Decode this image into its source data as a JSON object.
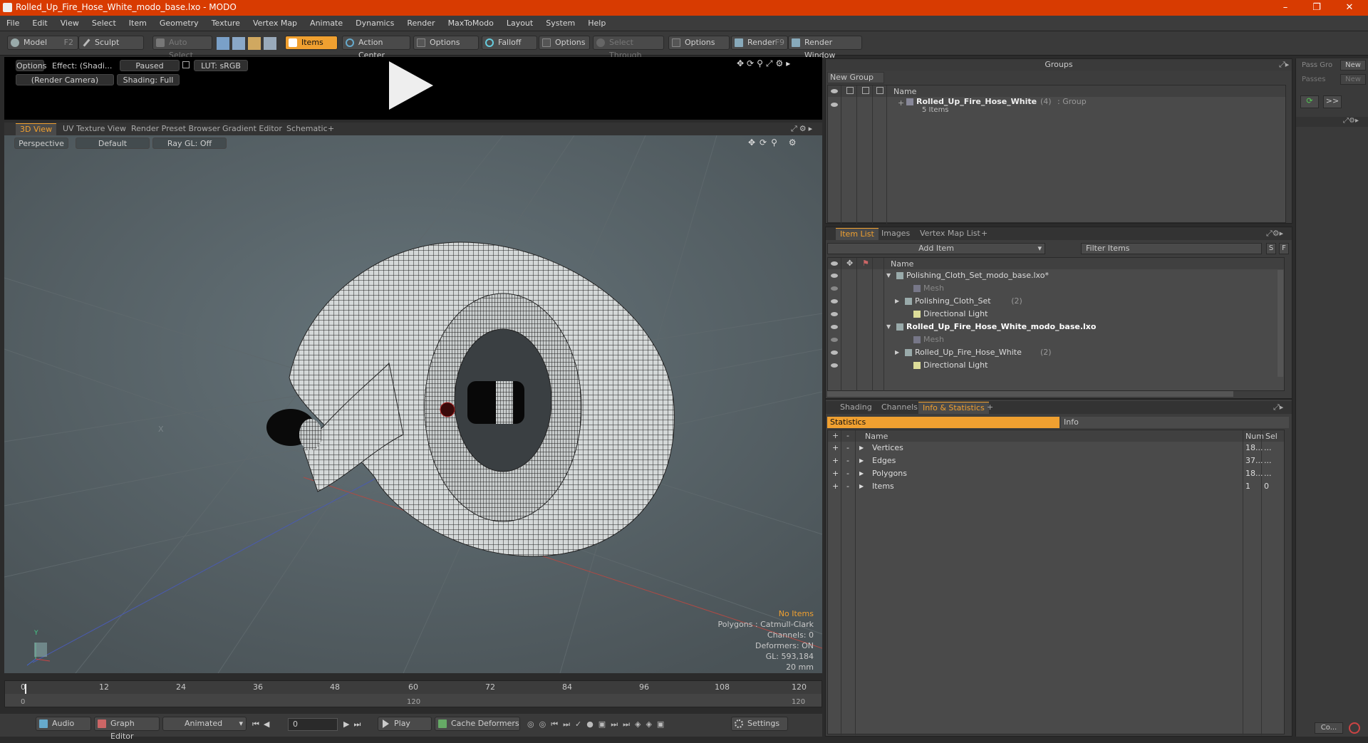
{
  "window": {
    "title": "Rolled_Up_Fire_Hose_White_modo_base.lxo - MODO"
  },
  "menu": [
    "File",
    "Edit",
    "View",
    "Select",
    "Item",
    "Geometry",
    "Texture",
    "Vertex Map",
    "Animate",
    "Dynamics",
    "Render",
    "MaxToModo",
    "Layout",
    "System",
    "Help"
  ],
  "toolbar": {
    "model": "Model",
    "model_key": "F2",
    "sculpt": "Sculpt",
    "auto_select": "Auto Select",
    "items": "Items",
    "action_center": "Action Center",
    "options1": "Options",
    "falloff": "Falloff",
    "options2": "Options",
    "select_through": "Select Through",
    "options3": "Options",
    "render": "Render",
    "render_key": "F9",
    "render_window": "Render Window"
  },
  "preview": {
    "options": "Options",
    "effect": "Effect: (Shadi...",
    "paused": "Paused",
    "lut": "LUT: sRGB",
    "camera": "(Render Camera)",
    "shading": "Shading: Full"
  },
  "viewtabs": [
    "3D View",
    "UV Texture View",
    "Render Preset Browser",
    "Gradient Editor",
    "Schematic",
    "+"
  ],
  "viewport": {
    "perspective": "Perspective",
    "default": "Default",
    "raygl": "Ray GL: Off",
    "axis_x": "X",
    "axis_y": "Y",
    "stats": {
      "no_items": "No Items",
      "polygons": "Polygons : Catmull-Clark",
      "channels": "Channels: 0",
      "deformers": "Deformers: ON",
      "gl": "GL: 593,184",
      "scale": "20 mm"
    }
  },
  "timeline": {
    "ticks": [
      "0",
      "12",
      "24",
      "36",
      "48",
      "60",
      "72",
      "84",
      "96",
      "108",
      "120"
    ],
    "start": "0",
    "mid": "120",
    "end": "120"
  },
  "bottom": {
    "audio": "Audio",
    "graph_editor": "Graph Editor",
    "animated": "Animated",
    "frame": "0",
    "play": "Play",
    "cache": "Cache Deformers",
    "settings": "Settings"
  },
  "groups": {
    "title": "Groups",
    "new_group": "New Group",
    "col_name": "Name",
    "item_name": "Rolled_Up_Fire_Hose_White",
    "item_count": "(4)",
    "item_type": ": Group",
    "item_sub": "5 Items"
  },
  "passes": {
    "pass_label": "Pass Gro",
    "new1": "New",
    "passes_label": "Passes",
    "new2": "New"
  },
  "itemlist": {
    "tabs": [
      "Item List",
      "Images",
      "Vertex Map List",
      "+"
    ],
    "add_item": "Add Item",
    "filter": "Filter Items",
    "s": "S",
    "f": "F",
    "col_name": "Name",
    "rows": [
      {
        "label": "Polishing_Cloth_Set_modo_base.lxo*",
        "indent": 0,
        "bold": false,
        "dim": false,
        "arrow": "▼"
      },
      {
        "label": "Mesh",
        "indent": 2,
        "bold": false,
        "dim": true,
        "arrow": ""
      },
      {
        "label": "Polishing_Cloth_Set",
        "count": "(2)",
        "indent": 1,
        "bold": false,
        "dim": false,
        "arrow": "▶"
      },
      {
        "label": "Directional Light",
        "indent": 2,
        "bold": false,
        "dim": false,
        "arrow": ""
      },
      {
        "label": "Rolled_Up_Fire_Hose_White_modo_base.lxo",
        "indent": 0,
        "bold": true,
        "dim": false,
        "arrow": "▼"
      },
      {
        "label": "Mesh",
        "indent": 2,
        "bold": false,
        "dim": true,
        "arrow": ""
      },
      {
        "label": "Rolled_Up_Fire_Hose_White",
        "count": "(2)",
        "indent": 1,
        "bold": false,
        "dim": false,
        "arrow": "▶"
      },
      {
        "label": "Directional Light",
        "indent": 2,
        "bold": false,
        "dim": false,
        "arrow": ""
      }
    ]
  },
  "info": {
    "tabs": [
      "Shading",
      "Channels",
      "Info & Statistics",
      "+"
    ],
    "statistics": "Statistics",
    "info": "Info",
    "col_name": "Name",
    "col_num": "Num",
    "col_sel": "Sel",
    "rows": [
      {
        "name": "Vertices",
        "num": "18...",
        "sel": "..."
      },
      {
        "name": "Edges",
        "num": "37...",
        "sel": "..."
      },
      {
        "name": "Polygons",
        "num": "18...",
        "sel": "..."
      },
      {
        "name": "Items",
        "num": "1",
        "sel": "0"
      }
    ]
  },
  "side": {
    "more": ">>",
    "co": "Co..."
  }
}
